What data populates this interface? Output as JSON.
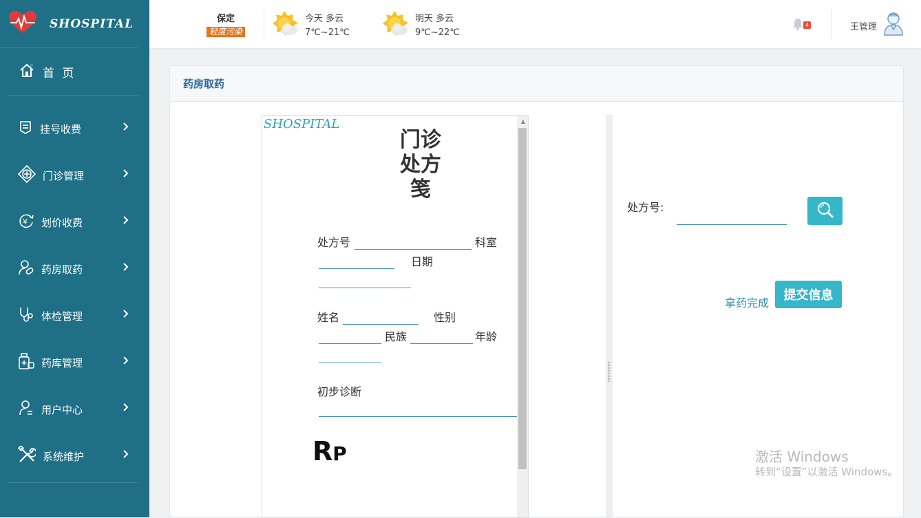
{
  "app": {
    "logo_text": "SHOSPITAL"
  },
  "sidebar": {
    "home_label": "首 页",
    "items": [
      {
        "label": "挂号收费",
        "icon": "registration-icon"
      },
      {
        "label": "门诊管理",
        "icon": "medical-cross-icon"
      },
      {
        "label": "划价收费",
        "icon": "yuan-refresh-icon"
      },
      {
        "label": "药房取药",
        "icon": "user-pill-icon"
      },
      {
        "label": "体检管理",
        "icon": "stethoscope-icon"
      },
      {
        "label": "药库管理",
        "icon": "medicine-bottle-icon"
      },
      {
        "label": "用户中心",
        "icon": "user-icon"
      },
      {
        "label": "系统维护",
        "icon": "tools-icon"
      }
    ]
  },
  "header": {
    "city": "保定",
    "air_quality": "轻度污染",
    "today": {
      "label": "今天  多云",
      "temp": "7℃~21℃"
    },
    "tomorrow": {
      "label": "明天  多云",
      "temp": "9℃~22℃"
    },
    "notification_count": "4",
    "user_name": "王管理"
  },
  "panel": {
    "title": "药房取药"
  },
  "prescription": {
    "logo": "SHOSPITAL",
    "title": "门诊处方笺",
    "rx_no_label": "处方号",
    "dept_label": "科室",
    "date_label": "日期",
    "name_label": "姓名",
    "gender_label": "性别",
    "ethnicity_label": "民族",
    "age_label": "年龄",
    "diagnosis_label": "初步诊断",
    "rp_R": "R",
    "rp_P": "P"
  },
  "form": {
    "rx_no_label": "处方号:",
    "rx_no_value": "",
    "done_link": "拿药完成",
    "submit_label": "提交信息"
  },
  "watermark": {
    "line1": "激活 Windows",
    "line2": "转到“设置”以激活 Windows。"
  },
  "colors": {
    "sidebar": "#1f6f86",
    "accent": "#35b6c9",
    "air_quality": "#e8731a",
    "badge": "#e74c3c"
  }
}
